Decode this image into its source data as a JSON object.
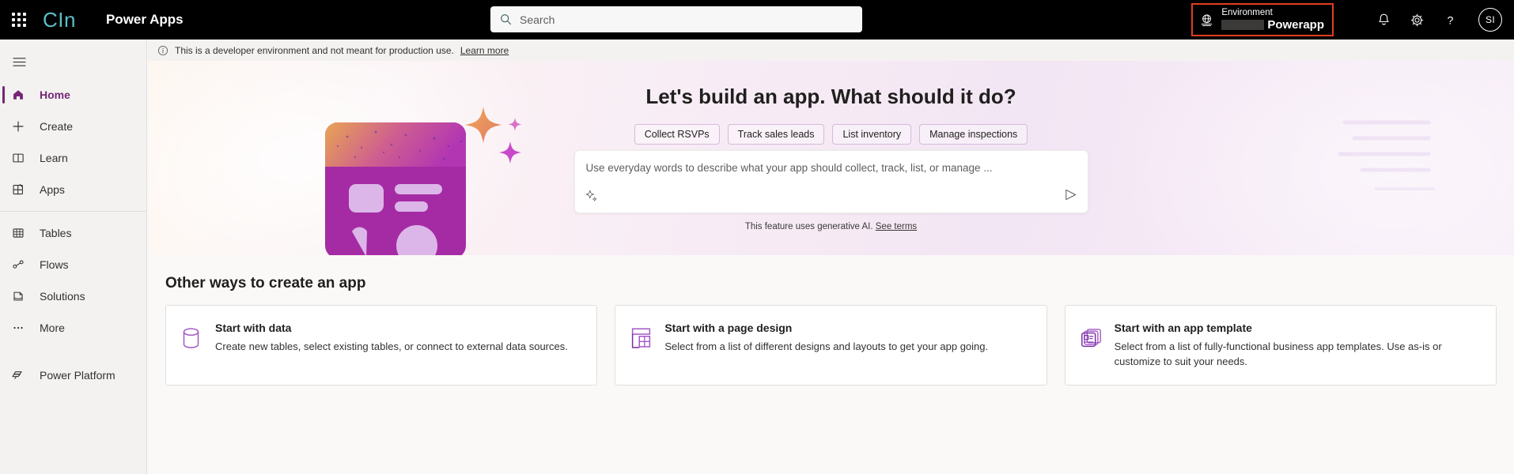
{
  "header": {
    "waffle_icon": "app-launcher-icon",
    "brand_logo": "CIn",
    "app_title": "Power Apps",
    "search": {
      "placeholder": "Search",
      "value": "",
      "icon": "search-icon"
    },
    "environment": {
      "icon": "environment-globe-icon",
      "label": "Environment",
      "name": "Powerapp",
      "redacted": true,
      "highlight_color": "#e03e1f"
    },
    "notifications_icon": "bell-icon",
    "settings_icon": "gear-icon",
    "help_icon": "question-mark-icon",
    "avatar_initials": "SI"
  },
  "sidebar": {
    "menu_icon": "hamburger-icon",
    "items": [
      {
        "label": "Home",
        "icon": "home-icon",
        "selected": true
      },
      {
        "label": "Create",
        "icon": "plus-icon",
        "selected": false
      },
      {
        "label": "Learn",
        "icon": "book-icon",
        "selected": false
      },
      {
        "label": "Apps",
        "icon": "apps-grid-icon",
        "selected": false
      }
    ],
    "items2": [
      {
        "label": "Tables",
        "icon": "table-grid-icon",
        "selected": false
      },
      {
        "label": "Flows",
        "icon": "flow-icon",
        "selected": false
      },
      {
        "label": "Solutions",
        "icon": "solutions-icon",
        "selected": false
      },
      {
        "label": "More",
        "icon": "ellipsis-icon",
        "selected": false
      }
    ],
    "bottom": {
      "label": "Power Platform",
      "icon": "power-platform-icon"
    },
    "accent_color": "#742774"
  },
  "notice": {
    "icon": "info-circle-icon",
    "text": "This is a developer environment and not meant for production use.",
    "link": "Learn more"
  },
  "hero": {
    "title": "Let's build an app. What should it do?",
    "chips": [
      {
        "label": "Collect RSVPs"
      },
      {
        "label": "Track sales leads"
      },
      {
        "label": "List inventory"
      },
      {
        "label": "Manage inspections"
      }
    ],
    "prompt": {
      "placeholder": "Use everyday words to describe what your app should collect, track, list, or manage ...",
      "value": "",
      "sparkle_icon": "sparkle-ai-icon",
      "send_icon": "send-arrow-icon"
    },
    "ai_note": "This feature uses generative AI.",
    "ai_terms_link": "See terms"
  },
  "other_ways": {
    "title": "Other ways to create an app",
    "cards": [
      {
        "icon": "database-cylinder-icon",
        "title": "Start with data",
        "description": "Create new tables, select existing tables, or connect to external data sources."
      },
      {
        "icon": "page-design-icon",
        "title": "Start with a page design",
        "description": "Select from a list of different designs and layouts to get your app going."
      },
      {
        "icon": "app-template-icon",
        "title": "Start with an app template",
        "description": "Select from a list of fully-functional business app templates. Use as-is or customize to suit your needs."
      }
    ]
  }
}
